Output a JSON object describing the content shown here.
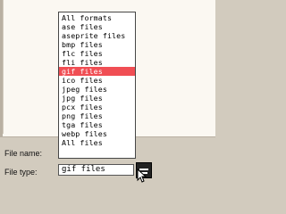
{
  "dialog": {
    "file_name_label": "File name:",
    "file_type_label": "File type:",
    "file_type_value": "gif files",
    "file_type_button_icon": "dropdown-toggle-icon",
    "selected_option_color": "#f04e54"
  },
  "dropdown": {
    "options": [
      "All formats",
      "ase files",
      "aseprite files",
      "bmp files",
      "flc files",
      "fli files",
      "gif files",
      "ico files",
      "jpeg files",
      "jpg files",
      "pcx files",
      "png files",
      "tga files",
      "webp files",
      "All files"
    ],
    "selected_index": 6
  }
}
